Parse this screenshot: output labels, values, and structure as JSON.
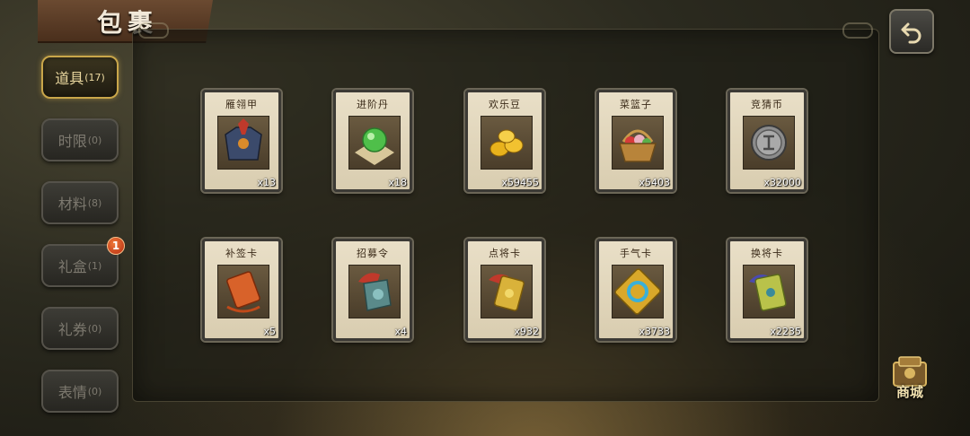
{
  "header": {
    "title": "包裹"
  },
  "tabs": [
    {
      "label": "道具",
      "count": "(17)"
    },
    {
      "label": "时限",
      "count": "(0)"
    },
    {
      "label": "材料",
      "count": "(8)"
    },
    {
      "label": "礼盒",
      "count": "(1)"
    },
    {
      "label": "礼券",
      "count": "(0)"
    },
    {
      "label": "表情",
      "count": "(0)"
    }
  ],
  "badge": "1",
  "shop": {
    "label": "商城"
  },
  "items": [
    {
      "name": "雁翎甲",
      "count": "x13",
      "icon": "armor-icon"
    },
    {
      "name": "进阶丹",
      "count": "x18",
      "icon": "pill-icon"
    },
    {
      "name": "欢乐豆",
      "count": "x59455",
      "icon": "gold-beans-icon"
    },
    {
      "name": "菜篮子",
      "count": "x5403",
      "icon": "basket-icon"
    },
    {
      "name": "竞猜币",
      "count": "x32000",
      "icon": "coin-icon"
    },
    {
      "name": "补签卡",
      "count": "x5",
      "icon": "sign-card-icon"
    },
    {
      "name": "招募令",
      "count": "x4",
      "icon": "recruit-token-icon"
    },
    {
      "name": "点将卡",
      "count": "x932",
      "icon": "general-card-icon"
    },
    {
      "name": "手气卡",
      "count": "x3733",
      "icon": "luck-card-icon"
    },
    {
      "name": "换将卡",
      "count": "x2235",
      "icon": "swap-general-card-icon"
    }
  ],
  "colors": {
    "accent": "#c9a64a",
    "card": "#e9dfc7",
    "badge": "#d4451c"
  }
}
